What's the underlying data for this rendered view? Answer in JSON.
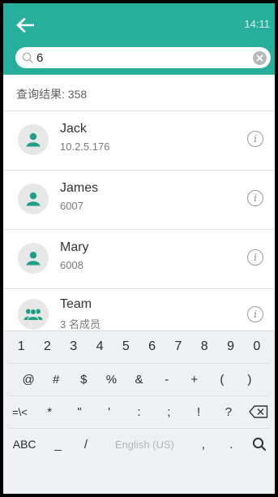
{
  "status": {
    "time": "14:11"
  },
  "search": {
    "value": "6"
  },
  "results": {
    "label": "查询结果: 358"
  },
  "contacts": [
    {
      "name": "Jack",
      "sub": "10.2.5.176",
      "icon": "person-icon"
    },
    {
      "name": "James",
      "sub": "6007",
      "icon": "person-icon"
    },
    {
      "name": "Mary",
      "sub": "6008",
      "icon": "person-icon"
    },
    {
      "name": "Team",
      "sub": "3 名成员",
      "icon": "group-icon"
    }
  ],
  "keyboard": {
    "row1": [
      "1",
      "2",
      "3",
      "4",
      "5",
      "6",
      "7",
      "8",
      "9",
      "0"
    ],
    "row2": [
      "@",
      "#",
      "$",
      "%",
      "&",
      "-",
      "+",
      "(",
      ")"
    ],
    "row3": [
      "=\\<",
      "*",
      "\"",
      "'",
      ":",
      ";",
      "!",
      "?"
    ],
    "row4": {
      "abc": "ABC",
      "underscore": "_",
      "slash": "/",
      "space": "English (US)",
      "comma": ",",
      "period": "."
    }
  },
  "colors": {
    "accent": "#27ae9d",
    "avatar_icon": "#1f9e8b"
  }
}
